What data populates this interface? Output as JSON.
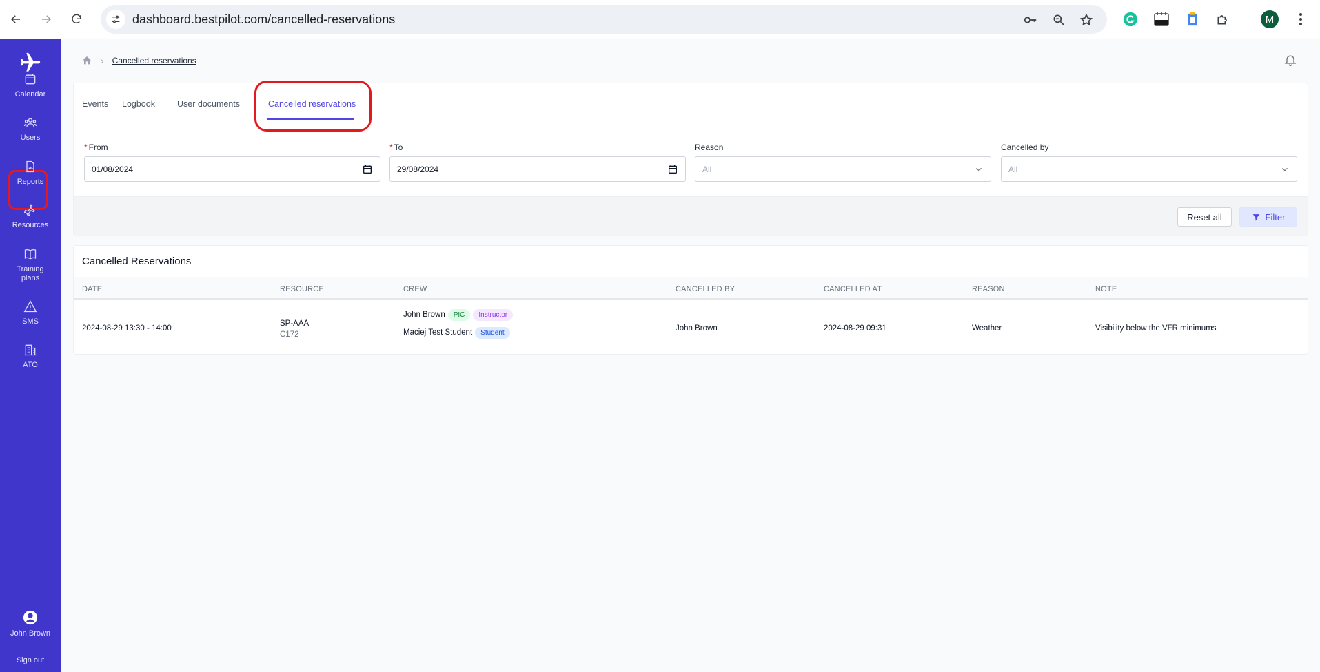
{
  "browser": {
    "url": "dashboard.bestpilot.com/cancelled-reservations",
    "profile_initial": "M"
  },
  "sidebar": {
    "items": [
      {
        "label": "Calendar",
        "icon": "calendar-icon"
      },
      {
        "label": "Users",
        "icon": "users-icon"
      },
      {
        "label": "Reports",
        "icon": "reports-icon"
      },
      {
        "label": "Resources",
        "icon": "plane-icon"
      },
      {
        "label": "Training\nplans",
        "icon": "book-icon"
      },
      {
        "label": "SMS",
        "icon": "warning-icon"
      },
      {
        "label": "ATO",
        "icon": "building-icon"
      }
    ],
    "user_name": "John Brown",
    "sign_out": "Sign out"
  },
  "breadcrumb": {
    "current": "Cancelled reservations"
  },
  "tabs": [
    {
      "label": "Events"
    },
    {
      "label": "Logbook"
    },
    {
      "label": "User documents"
    },
    {
      "label": "Cancelled reservations",
      "active": true
    }
  ],
  "filters": {
    "from": {
      "label": "From",
      "value": "01/08/2024",
      "required": true
    },
    "to": {
      "label": "To",
      "value": "29/08/2024",
      "required": true
    },
    "reason": {
      "label": "Reason",
      "value": "All"
    },
    "cancelled_by": {
      "label": "Cancelled by",
      "value": "All"
    },
    "reset_label": "Reset all",
    "filter_label": "Filter"
  },
  "table": {
    "title": "Cancelled Reservations",
    "columns": [
      "DATE",
      "RESOURCE",
      "CREW",
      "CANCELLED BY",
      "CANCELLED AT",
      "REASON",
      "NOTE"
    ],
    "rows": [
      {
        "date": "2024-08-29 13:30 - 14:00",
        "resource": "SP-AAA",
        "resource_type": "C172",
        "crew": [
          {
            "name": "John Brown",
            "roles": [
              "PIC",
              "Instructor"
            ]
          },
          {
            "name": "Maciej Test Student",
            "roles": [
              "Student"
            ]
          }
        ],
        "cancelled_by": "John Brown",
        "cancelled_at": "2024-08-29 09:31",
        "reason": "Weather",
        "note": "Visibility below the VFR minimums"
      }
    ]
  },
  "colors": {
    "sidebar": "#4136cc",
    "accent": "#4f46e5",
    "highlight": "#e3191f"
  }
}
